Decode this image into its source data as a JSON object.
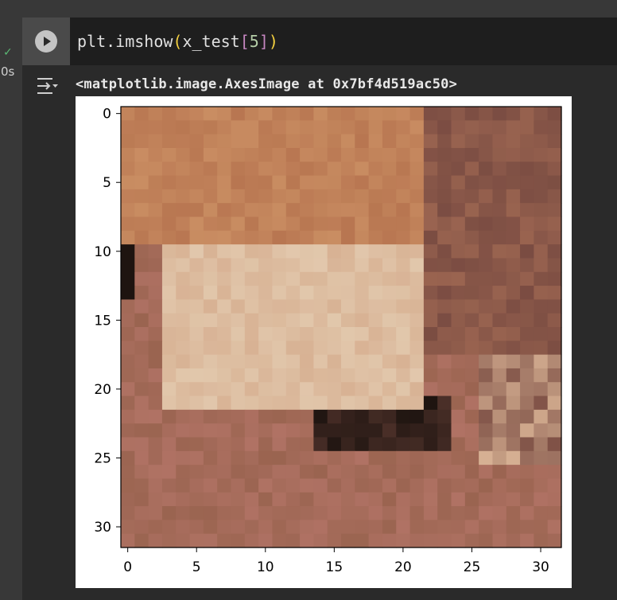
{
  "execution": {
    "status_icon": "check-icon",
    "status_symbol": "✓",
    "elapsed": "0s"
  },
  "cell": {
    "run_icon": "play-icon",
    "code": {
      "func": "plt.imshow",
      "paren_open": "(",
      "arg": "x_test",
      "bracket_open": "[",
      "index": "5",
      "bracket_close": "]",
      "paren_close": ")"
    }
  },
  "output": {
    "toggle_icon": "output-collapse-icon",
    "text": "<matplotlib.image.AxesImage at 0x7bf4d519ac50>"
  },
  "chart_data": {
    "type": "heatmap",
    "description_source": "plt.imshow of a 32x32 RGB image",
    "grid_size": [
      32,
      32
    ],
    "x_ticks": [
      "0",
      "5",
      "10",
      "15",
      "20",
      "25",
      "30"
    ],
    "y_ticks": [
      "0",
      "5",
      "10",
      "15",
      "20",
      "25",
      "30"
    ],
    "xlim": [
      -0.5,
      31.5
    ],
    "ylim": [
      31.5,
      -0.5
    ],
    "palette": {
      "orange_light": "#c98d62",
      "orange": "#b87651",
      "brown_mid": "#9a6450",
      "brown_dark": "#7a4c42",
      "pink_brown": "#b07264",
      "beige": "#d8b294",
      "cream": "#e4cdb2",
      "black": "#1e1410"
    }
  }
}
